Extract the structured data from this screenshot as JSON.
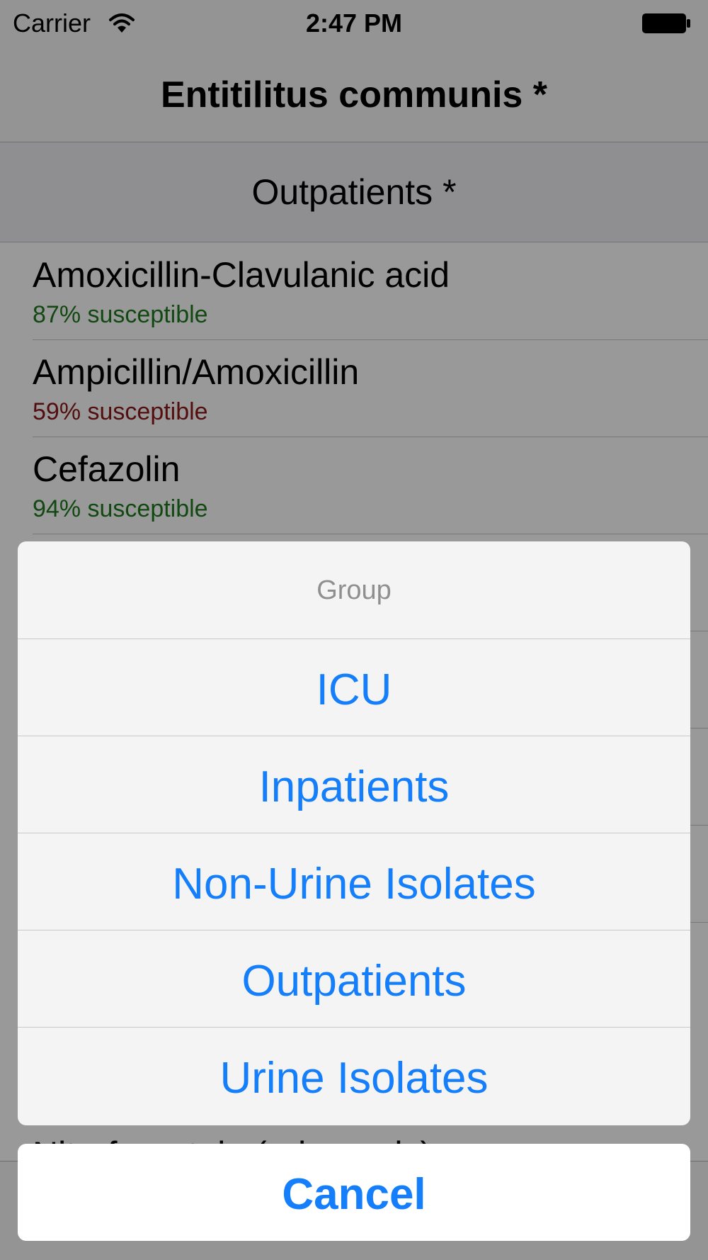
{
  "status_bar": {
    "carrier": "Carrier",
    "time": "2:47 PM"
  },
  "nav": {
    "title": "Entitilitus communis *"
  },
  "group_header": {
    "label": "Outpatients *"
  },
  "list": {
    "items": [
      {
        "name": "Amoxicillin-Clavulanic acid",
        "susceptibility": "87% susceptible",
        "status_color": "#1f7a1f"
      },
      {
        "name": "Ampicillin/Amoxicillin",
        "susceptibility": "59% susceptible",
        "status_color": "#8b1a1a"
      },
      {
        "name": "Cefazolin",
        "susceptibility": "94% susceptible",
        "status_color": "#1f7a1f"
      }
    ],
    "partially_visible_item": "Nitrofurantoin (urine only)"
  },
  "action_sheet": {
    "title": "Group",
    "options": [
      "ICU",
      "Inpatients",
      "Non-Urine Isolates",
      "Outpatients",
      "Urine Isolates"
    ],
    "cancel_label": "Cancel",
    "accent_color": "#147efb"
  }
}
